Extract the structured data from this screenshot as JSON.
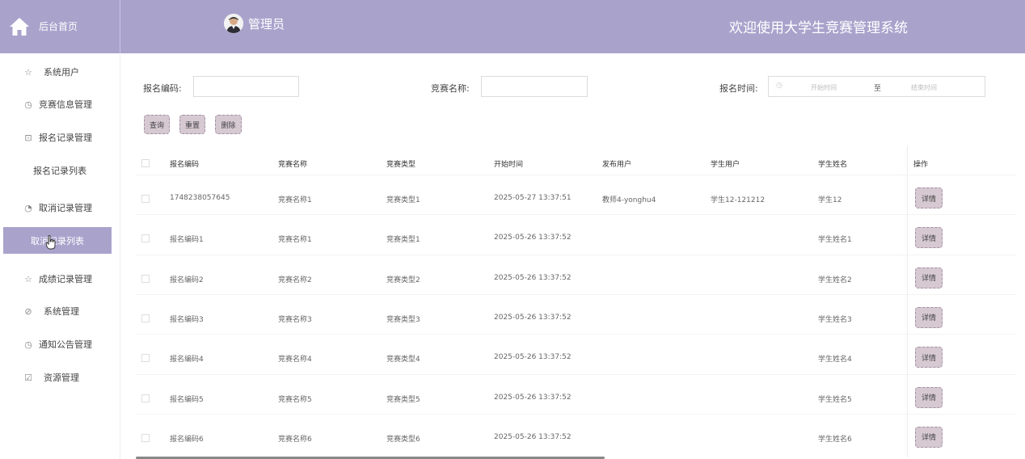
{
  "header": {
    "logo_text": "后台首页",
    "admin_name": "管理员",
    "welcome": "欢迎使用大学生竞赛管理系统"
  },
  "sidebar": {
    "items": [
      {
        "label": "系统用户",
        "icon": "star-icon"
      },
      {
        "label": "竞赛信息管理",
        "icon": "clock-icon"
      },
      {
        "label": "报名记录管理",
        "icon": "box-icon"
      },
      {
        "label": "报名记录列表",
        "sub": true
      },
      {
        "label": "取消记录管理",
        "icon": "circle-icon"
      },
      {
        "label": "取消记录列表",
        "sub": true,
        "active": true
      },
      {
        "label": "成绩记录管理",
        "icon": "star-icon"
      },
      {
        "label": "系统管理",
        "icon": "compass-icon"
      },
      {
        "label": "通知公告管理",
        "icon": "clock-icon"
      },
      {
        "label": "资源管理",
        "icon": "check-box-icon"
      }
    ]
  },
  "search": {
    "code_label": "报名编码:",
    "name_label": "竞赛名称:",
    "time_label": "报名时间:",
    "start_placeholder": "开始时间",
    "range_sep": "至",
    "end_placeholder": "结束时间",
    "query_btn": "查询",
    "reset_btn": "重置",
    "delete_btn": "删除"
  },
  "table": {
    "headers": [
      "报名编码",
      "竞赛名称",
      "竞赛类型",
      "开始时间",
      "发布用户",
      "学生用户",
      "学生姓名",
      "操作"
    ],
    "detail_label": "详情",
    "rows": [
      [
        "1748238057645",
        "竞赛名称1",
        "竞赛类型1",
        "2025-05-27 13:37:51",
        "教师4-yonghu4",
        "学生12-121212",
        "学生12"
      ],
      [
        "报名编码1",
        "竞赛名称1",
        "竞赛类型1",
        "2025-05-26 13:37:52",
        "",
        "",
        "学生姓名1"
      ],
      [
        "报名编码2",
        "竞赛名称2",
        "竞赛类型2",
        "2025-05-26 13:37:52",
        "",
        "",
        "学生姓名2"
      ],
      [
        "报名编码3",
        "竞赛名称3",
        "竞赛类型3",
        "2025-05-26 13:37:52",
        "",
        "",
        "学生姓名3"
      ],
      [
        "报名编码4",
        "竞赛名称4",
        "竞赛类型4",
        "2025-05-26 13:37:52",
        "",
        "",
        "学生姓名4"
      ],
      [
        "报名编码5",
        "竞赛名称5",
        "竞赛类型5",
        "2025-05-26 13:37:52",
        "",
        "",
        "学生姓名5"
      ],
      [
        "报名编码6",
        "竞赛名称6",
        "竞赛类型6",
        "2025-05-26 13:37:52",
        "",
        "",
        "学生姓名6"
      ]
    ]
  }
}
